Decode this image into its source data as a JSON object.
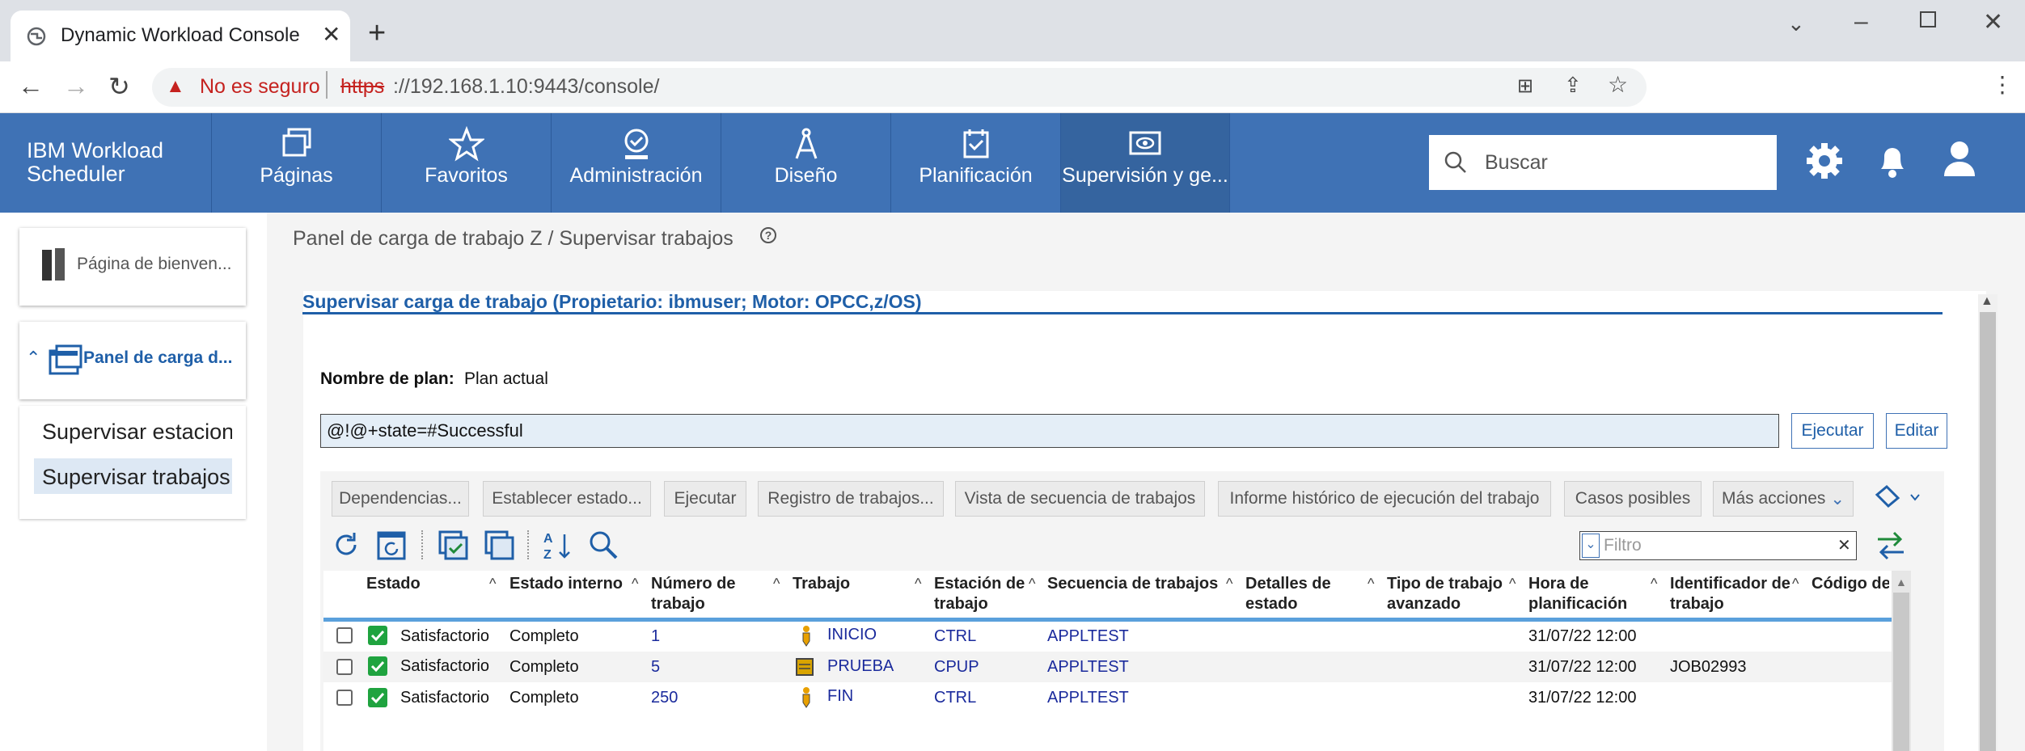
{
  "browser": {
    "tab_title": "Dynamic Workload Console",
    "security_label": "No es seguro",
    "url_scheme": "https",
    "url_rest": "://192.168.1.10:9443/console/"
  },
  "app": {
    "brand_line1": "IBM Workload",
    "brand_line2": "Scheduler",
    "search_placeholder": "Buscar",
    "nav": [
      "Páginas",
      "Favoritos",
      "Administración",
      "Diseño",
      "Planificación",
      "Supervisión y ge..."
    ]
  },
  "sidebar": {
    "welcome": "Página de bienven...",
    "workload": "Panel de carga d...",
    "items": [
      "Supervisar estacion",
      "Supervisar trabajos"
    ]
  },
  "breadcrumb": "Panel de carga de trabajo Z / Supervisar trabajos",
  "panel": {
    "title": "Supervisar carga de trabajo (Propietario: ibmuser; Motor: OPCC,z/OS)",
    "plan_label": "Nombre de plan:",
    "plan_value": "Plan actual",
    "query": "@!@+state=#Successful",
    "run_label": "Ejecutar",
    "edit_label": "Editar",
    "actions": [
      "Dependencias...",
      "Establecer estado...",
      "Ejecutar",
      "Registro de trabajos...",
      "Vista de secuencia de trabajos",
      "Informe histórico de ejecución del trabajo",
      "Casos posibles",
      "Más acciones"
    ],
    "filter_placeholder": "Filtro"
  },
  "table": {
    "headers": [
      [
        "Estado",
        ""
      ],
      [
        "Estado interno",
        ""
      ],
      [
        "Número de",
        "trabajo"
      ],
      [
        "Trabajo",
        ""
      ],
      [
        "Estación de",
        "trabajo"
      ],
      [
        "Secuencia de trabajos",
        ""
      ],
      [
        "Detalles de",
        "estado"
      ],
      [
        "Tipo de trabajo",
        "avanzado"
      ],
      [
        "Hora de",
        "planificación"
      ],
      [
        "Identificador de",
        "trabajo"
      ],
      [
        "Código de",
        ""
      ]
    ],
    "rows": [
      {
        "estado": "Satisfactorio",
        "interno": "Completo",
        "numero": "1",
        "trabajo": "INICIO",
        "icon": "runner-icon",
        "estacion": "CTRL",
        "secuencia": "APPLTEST",
        "hora": "31/07/22 12:00",
        "id": ""
      },
      {
        "estado": "Satisfactorio",
        "interno": "Completo",
        "numero": "5",
        "trabajo": "PRUEBA",
        "icon": "cpu-job-icon",
        "estacion": "CPUP",
        "secuencia": "APPLTEST",
        "hora": "31/07/22 12:00",
        "id": "JOB02993"
      },
      {
        "estado": "Satisfactorio",
        "interno": "Completo",
        "numero": "250",
        "trabajo": "FIN",
        "icon": "runner-icon",
        "estacion": "CTRL",
        "secuencia": "APPLTEST",
        "hora": "31/07/22 12:00",
        "id": ""
      }
    ]
  },
  "colors": {
    "brand": "#3f72b5",
    "link": "#1a2a9c",
    "success": "#1fa33f"
  }
}
